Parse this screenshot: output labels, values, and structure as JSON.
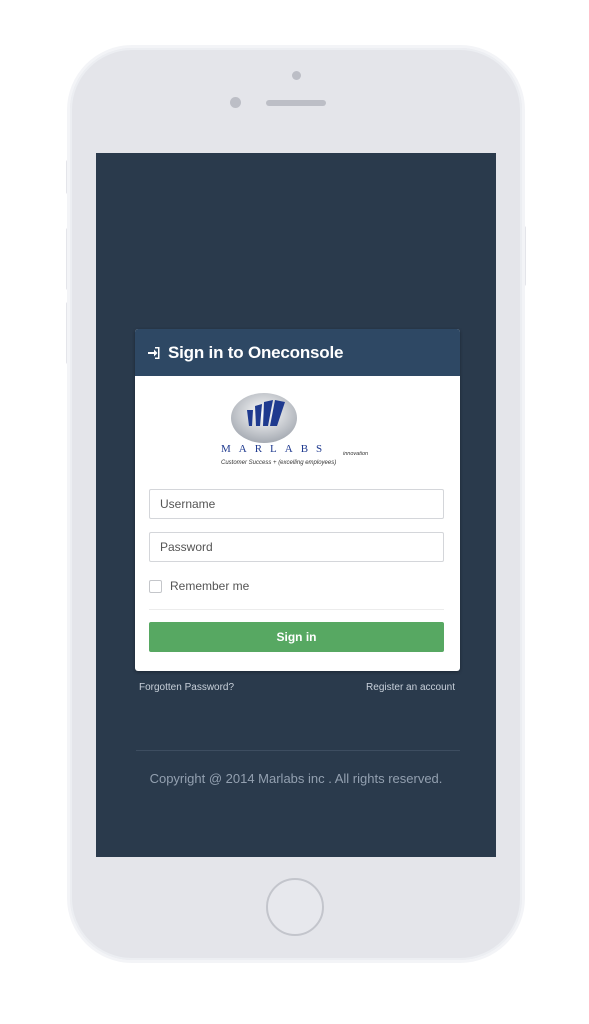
{
  "login": {
    "title": "Sign in to Oneconsole",
    "icon": "sign-in-icon",
    "logo": {
      "name": "MARLABS",
      "innovation": "innovation",
      "tagline": "Customer Success + (excelling employees)"
    },
    "username_placeholder": "Username",
    "password_placeholder": "Password",
    "remember_label": "Remember me",
    "remember_checked": false,
    "signin_button": "Sign in",
    "forgot_link": "Forgotten Password?",
    "register_link": "Register an account"
  },
  "footer": {
    "copyright": "Copyright @ 2014 Marlabs inc . All rights reserved."
  },
  "colors": {
    "background": "#2a3a4c",
    "header": "#2e4864",
    "button": "#57a862"
  }
}
